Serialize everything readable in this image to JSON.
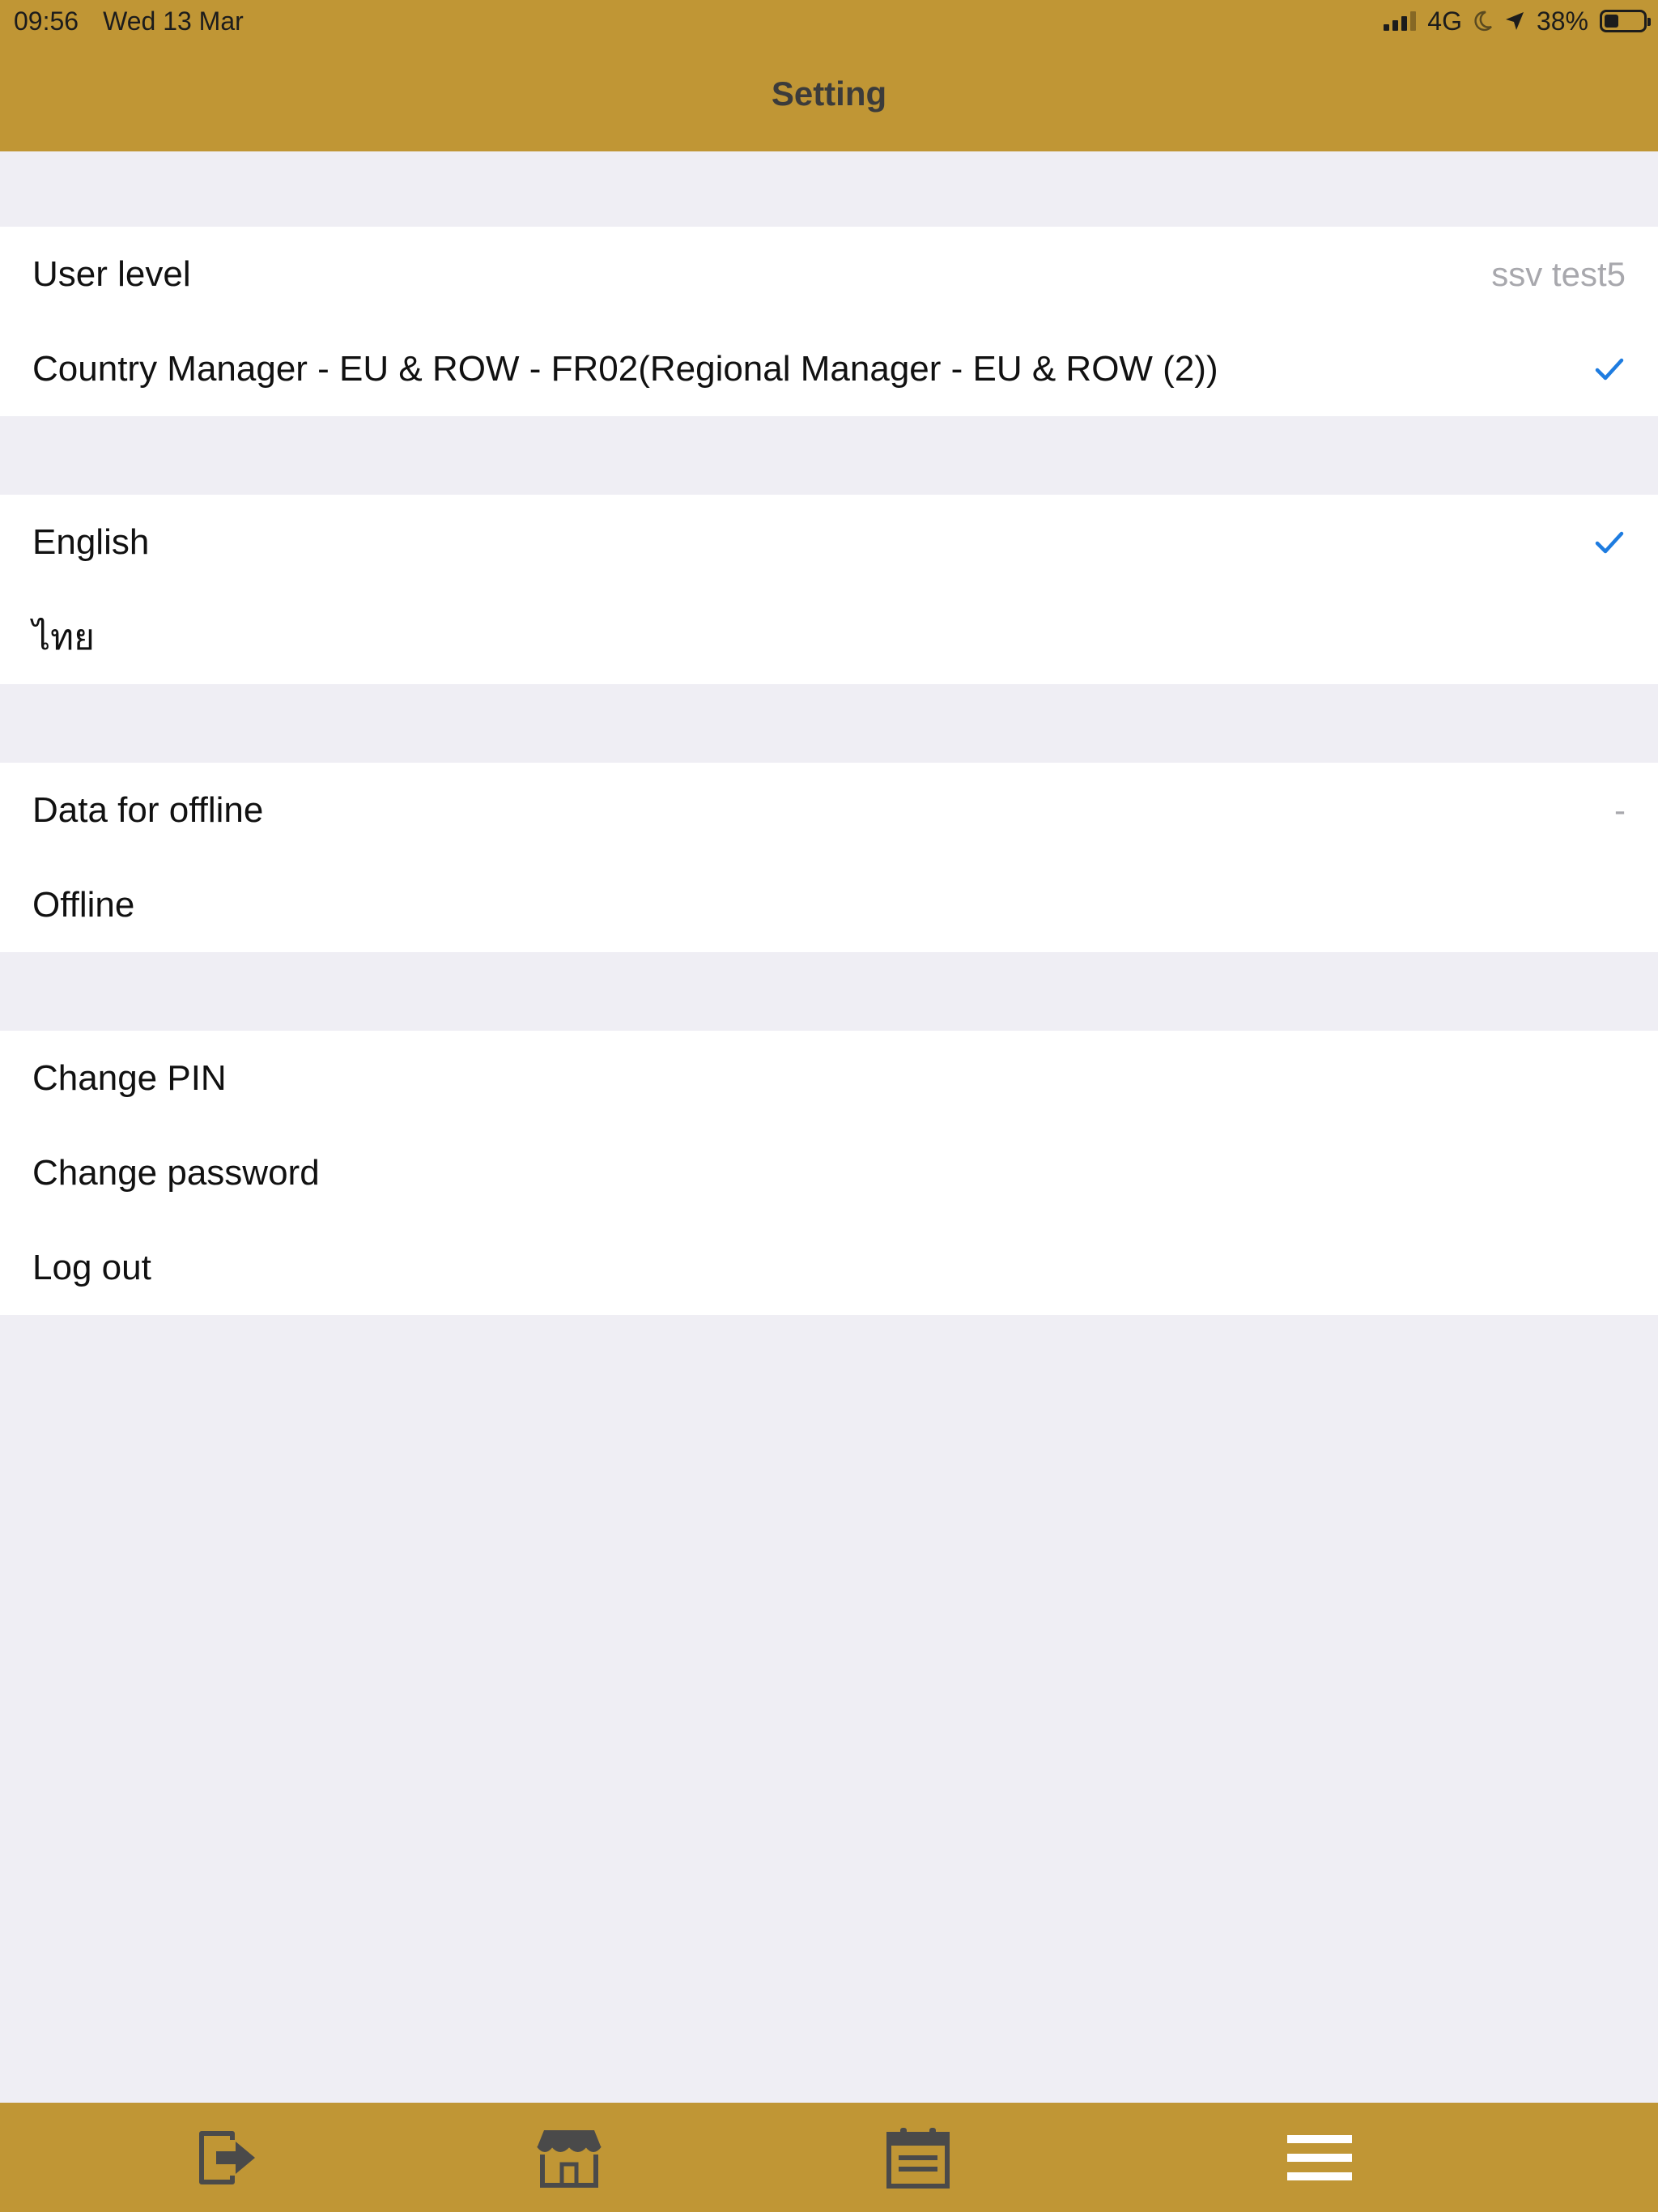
{
  "status_bar": {
    "time": "09:56",
    "date": "Wed 13 Mar",
    "network": "4G",
    "battery": "38%",
    "battery_level": 0.38
  },
  "header": {
    "title": "Setting"
  },
  "user_section": {
    "label": "User level",
    "value": "ssv test5",
    "selected_level": "Country Manager - EU & ROW - FR02(Regional Manager - EU & ROW (2))",
    "selected_checked": true
  },
  "language_section": {
    "options": [
      {
        "label": "English",
        "checked": true
      },
      {
        "label": "ไทย",
        "checked": false
      }
    ]
  },
  "offline_section": {
    "data_label": "Data for offline",
    "data_value": "-",
    "offline_label": "Offline"
  },
  "account_section": {
    "change_pin": "Change PIN",
    "change_password": "Change password",
    "log_out": "Log out"
  },
  "tab_bar": {
    "items": [
      {
        "icon": "logout-arrow-icon"
      },
      {
        "icon": "store-icon"
      },
      {
        "icon": "calendar-icon"
      },
      {
        "icon": "menu-icon",
        "active": true
      }
    ]
  },
  "colors": {
    "accent": "#C09635",
    "check": "#1E7CE0",
    "background": "#EFEEF4"
  }
}
